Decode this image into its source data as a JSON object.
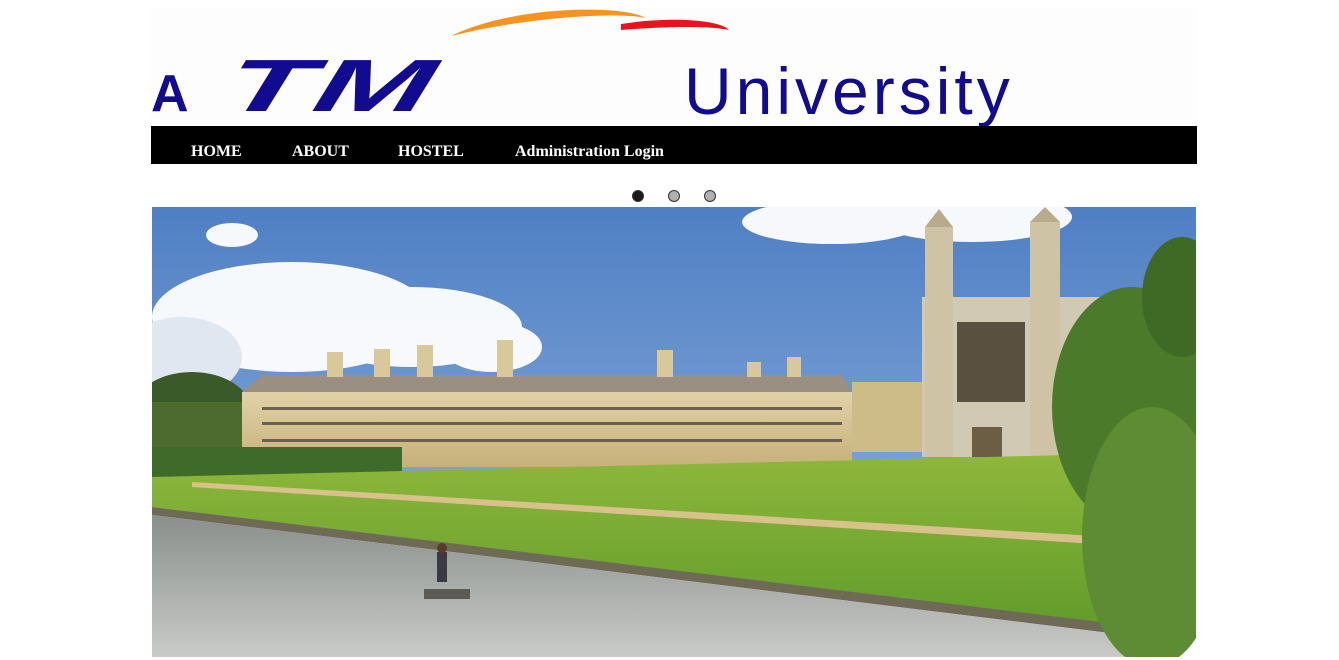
{
  "logo": {
    "prefix": "A",
    "brand": "TM",
    "suffix": "University",
    "colors": {
      "brand_blue": "#120a8f",
      "swoosh_orange": "#f7931e",
      "swoosh_red": "#e8141b"
    }
  },
  "nav": {
    "items": [
      {
        "label": "HOME"
      },
      {
        "label": "ABOUT"
      },
      {
        "label": "HOSTEL"
      },
      {
        "label": "Administration Login"
      }
    ]
  },
  "slider": {
    "dot_count": 3,
    "active_index": 0,
    "colors": {
      "active": "#1a1a1a",
      "inactive": "#b0b0b0"
    },
    "image": "campus-photo"
  }
}
